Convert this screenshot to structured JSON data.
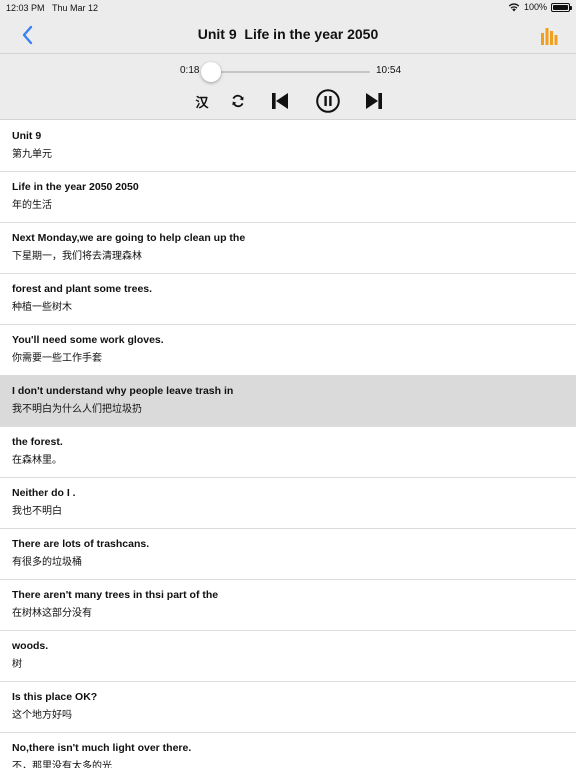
{
  "status_bar": {
    "time": "12:03 PM",
    "date": "Thu Mar 12",
    "battery": "100%"
  },
  "nav": {
    "title": "Unit 9  Life in the year 2050",
    "back_icon": "chevron-left-icon",
    "eq_icon": "equalizer-icon"
  },
  "player": {
    "elapsed": "0:18",
    "duration": "10:54",
    "progress": 0.03,
    "language_toggle": "汉",
    "accent_color": "#3a80f6"
  },
  "sentences": [
    {
      "en": "Unit 9",
      "cn": "第九单元"
    },
    {
      "en": "Life in the year 2050 2050",
      "cn": "年的生活"
    },
    {
      "en": "Next Monday,we are going to help clean up the",
      "cn": "下星期一，我们将去清理森林"
    },
    {
      "en": "forest and plant some trees.",
      "cn": "种植一些树木"
    },
    {
      "en": "You'll need some work gloves.",
      "cn": "你需要一些工作手套"
    },
    {
      "en": "I don't understand why people leave trash in",
      "cn": "我不明白为什么人们把垃圾扔"
    },
    {
      "en": "the forest.",
      "cn": "在森林里。"
    },
    {
      "en": "Neither do I .",
      "cn": "我也不明白"
    },
    {
      "en": "There are lots of trashcans.",
      "cn": "有很多的垃圾桶"
    },
    {
      "en": "There aren't many trees in thsi part of the",
      "cn": "在树林这部分没有"
    },
    {
      "en": "woods.",
      "cn": "树"
    },
    {
      "en": "Is this place OK?",
      "cn": "这个地方好吗"
    },
    {
      "en": "No,there isn't much light over there.",
      "cn": "不，那里没有太多的光"
    }
  ],
  "selected_index": 5
}
